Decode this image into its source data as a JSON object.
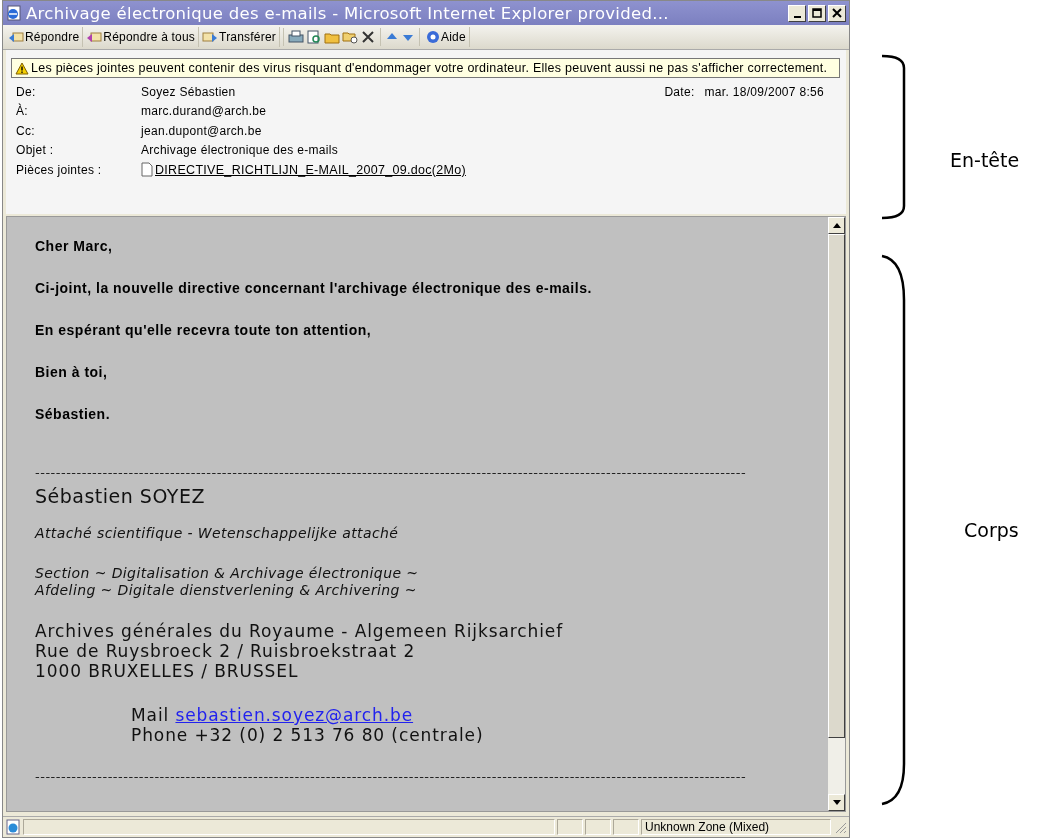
{
  "window": {
    "title": "Archivage électronique des e-mails - Microsoft Internet Explorer provided..."
  },
  "toolbar": {
    "reply": "Répondre",
    "reply_all": "Répondre à tous",
    "forward": "Transférer",
    "help": "Aide"
  },
  "warning": "Les pièces jointes peuvent contenir des virus risquant d'endommager votre ordinateur. Elles peuvent aussi ne pas s'afficher correctement.",
  "header": {
    "fields": [
      {
        "kind": "text",
        "label": "De:",
        "value": "Soyez Sébastien"
      },
      {
        "kind": "text",
        "label": "À:",
        "value": "marc.durand@arch.be"
      },
      {
        "kind": "text",
        "label": "Cc:",
        "value": "jean.dupont@arch.be"
      },
      {
        "kind": "text",
        "label": "Objet :",
        "value": "Archivage électronique des e-mails"
      },
      {
        "kind": "attachment",
        "label": "Pièces jointes :",
        "value": "DIRECTIVE_RICHTLIJN_E-MAIL_2007_09.doc(2Mo)"
      }
    ],
    "date_label": "Date:",
    "date": "mar. 18/09/2007 8:56"
  },
  "body": {
    "paragraphs": [
      "Cher Marc,",
      "Ci-joint, la nouvelle directive concernant l'archivage électronique des e-mails.",
      "En espérant qu'elle recevra toute ton attention,",
      "Bien à toi,",
      "Sébastien."
    ],
    "separator": "-----------------------------------------------------------------------------------------------------------------------------------------",
    "signature": {
      "name": "Sébastien SOYEZ",
      "role": "Attaché scientifique - Wetenschappelijke attaché",
      "section": [
        "Section ~ Digitalisation & Archivage électronique ~",
        "Afdeling ~ Digitale dienstverlening & Archivering ~"
      ],
      "address": [
        "Archives générales du Royaume - Algemeen Rijksarchief",
        "Rue de Ruysbroeck 2 / Ruisbroekstraat 2",
        "1000 BRUXELLES / BRUSSEL"
      ],
      "mail_label": "Mail",
      "mail": "sebastien.soyez@arch.be",
      "phone": "Phone +32 (0) 2 513 76 80 (centrale)"
    },
    "end_separator": "-----------------------------------------------------------------------------------------------------------------------------------------"
  },
  "status_bar": {
    "zone": "Unknown Zone (Mixed)"
  },
  "annotations": [
    {
      "label": "En-tête"
    },
    {
      "label": "Corps"
    }
  ]
}
